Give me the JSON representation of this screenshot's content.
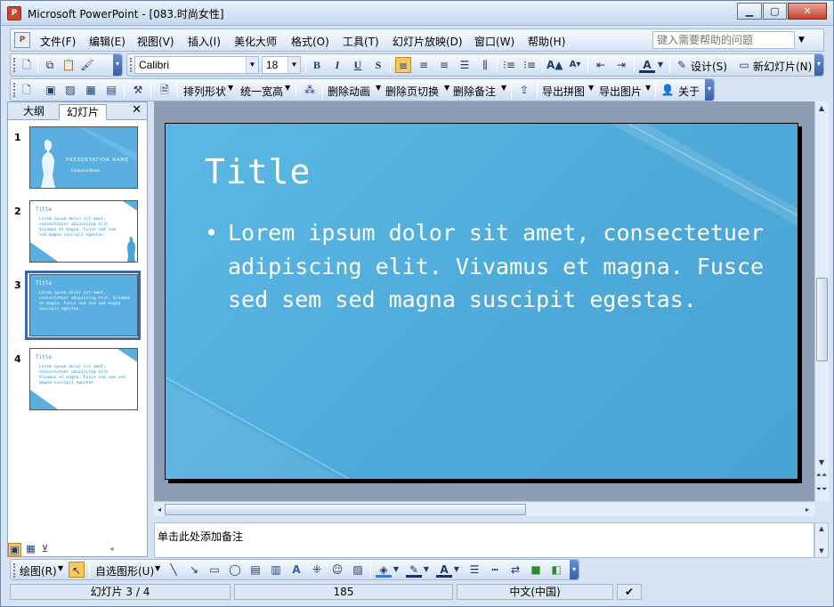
{
  "window": {
    "title": "Microsoft PowerPoint - [083.时尚女性]",
    "app_icon": "P"
  },
  "menubar": {
    "items": [
      "文件(F)",
      "编辑(E)",
      "视图(V)",
      "插入(I)",
      "美化大师",
      "格式(O)",
      "工具(T)",
      "幻灯片放映(D)",
      "窗口(W)",
      "帮助(H)"
    ],
    "help_placeholder": "键入需要帮助的问题"
  },
  "formatting_toolbar": {
    "font": "Calibri",
    "size": "18",
    "design_label": "设计(S)",
    "new_slide_label": "新幻灯片(N)"
  },
  "addon_toolbar": {
    "arrange_label": "排列形状",
    "uniform_width_label": "统一宽高",
    "delete_animation_label": "删除动画",
    "delete_transition_label": "删除页切换",
    "delete_notes_label": "删除备注",
    "export_collage_label": "导出拼图",
    "export_images_label": "导出图片",
    "about_label": "关于"
  },
  "left_pane": {
    "tabs": [
      "大纲",
      "幻灯片"
    ],
    "selected_tab": 1,
    "thumbnails": [
      {
        "number": "1",
        "title": "PRESENTATION NAME",
        "subtitle": "Company Name"
      },
      {
        "number": "2",
        "title": "Title",
        "body": "Lorem ipsum dolor sit amet, consectetuer adipiscing elit. Vivamus et magna. Fusce sed sem sed magna suscipit egestas."
      },
      {
        "number": "3",
        "title": "Title",
        "body": "Lorem ipsum dolor sit amet, consectetuer adipiscing elit. Vivamus et magna. Fusce sed sem sed magna suscipit egestas."
      },
      {
        "number": "4",
        "title": "Title",
        "body": "Lorem ipsum dolor sit amet, consectetuer adipiscing elit. Vivamus et magna. Fusce sed sem sed magna suscipit egestas."
      }
    ],
    "selected_index": 2
  },
  "slide": {
    "title": "Title",
    "bullet": "•",
    "body": "Lorem ipsum dolor sit amet, consectetuer adipiscing elit. Vivamus et magna. Fusce sed sem sed magna suscipit egestas."
  },
  "notes": {
    "placeholder": "单击此处添加备注"
  },
  "drawing_toolbar": {
    "draw_label": "绘图(R)",
    "autoshapes_label": "自选图形(U)"
  },
  "statusbar": {
    "slide_indicator": "幻灯片 3 / 4",
    "design_number": "185",
    "language": "中文(中国)"
  },
  "colors": {
    "slide_background": "#4fabd9",
    "slide_text": "#ffffff",
    "selection_border": "#3667b0",
    "toolbar_gradient_end": "#3a5fa5"
  }
}
